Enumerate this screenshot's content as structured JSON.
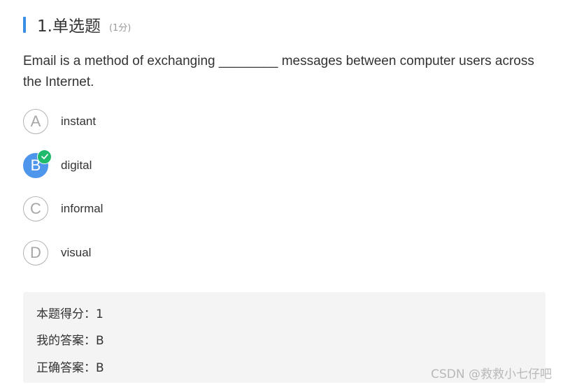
{
  "question": {
    "title": "1.单选题",
    "score": "(1分)",
    "text": "Email is a method of exchanging ________ messages between computer users across the Internet."
  },
  "options": [
    {
      "letter": "A",
      "text": "instant",
      "selected": false
    },
    {
      "letter": "B",
      "text": "digital",
      "selected": true
    },
    {
      "letter": "C",
      "text": "informal",
      "selected": false
    },
    {
      "letter": "D",
      "text": "visual",
      "selected": false
    }
  ],
  "result": {
    "score_line": "本题得分：1",
    "my_answer_line": "我的答案：B",
    "correct_answer_line": "正确答案：B"
  },
  "watermark": "CSDN @救救小七仔吧",
  "colors": {
    "accent": "#3a8ee6",
    "selected": "#4e95ec",
    "check": "#1fba6b",
    "result_bg": "#f4f4f4"
  },
  "icons": {
    "check": "check-icon"
  }
}
